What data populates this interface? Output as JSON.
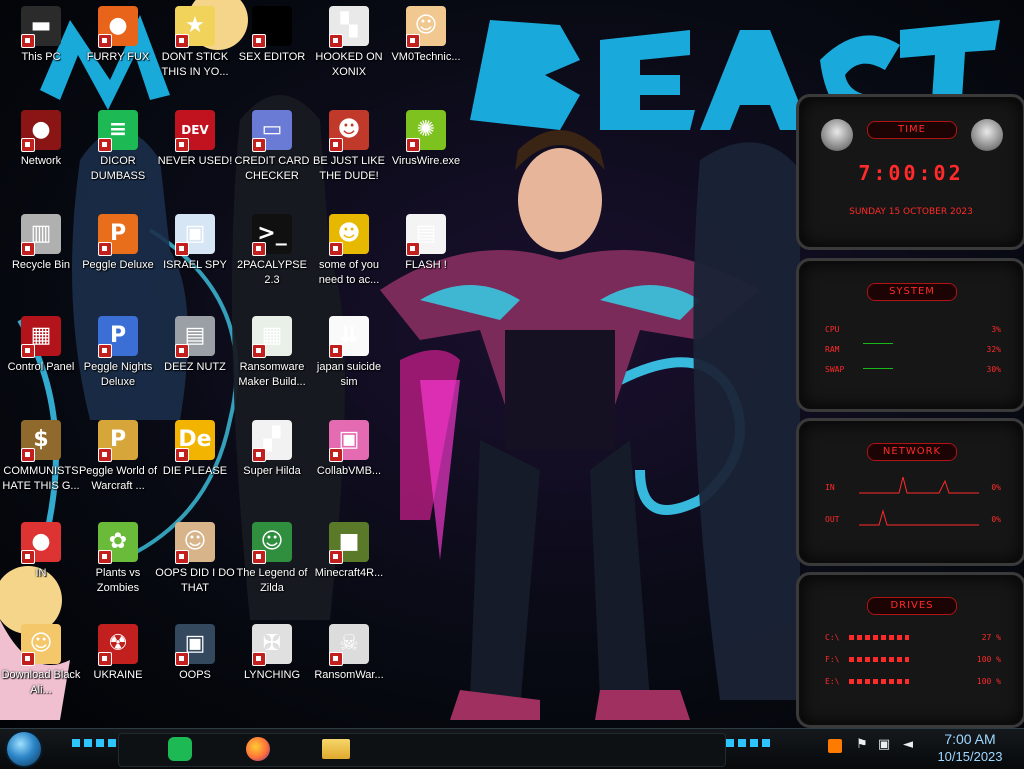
{
  "desktop": {
    "icons": [
      {
        "label": "This PC",
        "glyph": "▬",
        "bg": "#2b2b2b"
      },
      {
        "label": "FURRY FUX",
        "glyph": "●",
        "bg": "#e8641a"
      },
      {
        "label": "DONT STICK THIS IN YO...",
        "glyph": "★",
        "bg": "#f1d35c"
      },
      {
        "label": "SEX EDITOR",
        "glyph": "",
        "bg": "#000000"
      },
      {
        "label": "HOOKED ON XONIX",
        "glyph": "▚",
        "bg": "#e9e9e9"
      },
      {
        "label": "VM0Technic...",
        "glyph": "☺",
        "bg": "#f0c890"
      },
      {
        "label": "Network",
        "glyph": "●",
        "bg": "#8b1414"
      },
      {
        "label": "DICOR DUMBASS",
        "glyph": "≡",
        "bg": "#1db954"
      },
      {
        "label": "NEVER USED!",
        "glyph": "DEV",
        "bg": "#c1121f"
      },
      {
        "label": "CREDIT CARD CHECKER",
        "glyph": "▭",
        "bg": "#6a7bd6"
      },
      {
        "label": "BE JUST LIKE THE DUDE!",
        "glyph": "☻",
        "bg": "#c0392b"
      },
      {
        "label": "VirusWire.exe",
        "glyph": "✺",
        "bg": "#7dc21e"
      },
      {
        "label": "Recycle Bin",
        "glyph": "▥",
        "bg": "#b0b0b0"
      },
      {
        "label": "Peggle Deluxe",
        "glyph": "P",
        "bg": "#e86e1c"
      },
      {
        "label": "ISRAEL SPY",
        "glyph": "▣",
        "bg": "#d7e6f5"
      },
      {
        "label": "2PACALYPSE 2.3",
        "glyph": ">_",
        "bg": "#101010"
      },
      {
        "label": "some of you need to ac...",
        "glyph": "☻",
        "bg": "#e6b800"
      },
      {
        "label": "FLASH !",
        "glyph": "▤",
        "bg": "#f4f4f4"
      },
      {
        "label": "Control Panel",
        "glyph": "▦",
        "bg": "#b3141b"
      },
      {
        "label": "Peggle Nights Deluxe",
        "glyph": "P",
        "bg": "#3b6fd6"
      },
      {
        "label": "DEEZ NUTZ",
        "glyph": "▤",
        "bg": "#9aa0a6"
      },
      {
        "label": "Ransomware Maker Build...",
        "glyph": "▦",
        "bg": "#e8f0e8"
      },
      {
        "label": "japan suicide sim",
        "glyph": "⇊",
        "bg": "#fafafa"
      },
      {
        "label": "COMMUNISTS HATE THIS G...",
        "glyph": "$",
        "bg": "#8f6a2c"
      },
      {
        "label": "Peggle World of Warcraft ...",
        "glyph": "P",
        "bg": "#d7a63a"
      },
      {
        "label": "DIE PLEASE",
        "glyph": "De",
        "bg": "#f2b400"
      },
      {
        "label": "Super Hilda",
        "glyph": "▞",
        "bg": "#f2f2f2"
      },
      {
        "label": "CollabVMB...",
        "glyph": "▣",
        "bg": "#e46ab1"
      },
      {
        "label": "IN",
        "glyph": "●",
        "bg": "#d33"
      },
      {
        "label": "Plants vs Zombies",
        "glyph": "✿",
        "bg": "#6bbb3b"
      },
      {
        "label": "OOPS DID I DO THAT",
        "glyph": "☺",
        "bg": "#d8b48a"
      },
      {
        "label": "The Legend of Zilda",
        "glyph": "☺",
        "bg": "#2f8f3f"
      },
      {
        "label": "Minecraft4R...",
        "glyph": "■",
        "bg": "#5a7a2a"
      },
      {
        "label": "Download Black Ali...",
        "glyph": "☺",
        "bg": "#f4c86a"
      },
      {
        "label": "UKRAINE",
        "glyph": "☢",
        "bg": "#c21f1f"
      },
      {
        "label": "OOPS",
        "glyph": "▣",
        "bg": "#34495e"
      },
      {
        "label": "LYNCHING",
        "glyph": "✠",
        "bg": "#e0e0e0"
      },
      {
        "label": "RansomWar...",
        "glyph": "☠",
        "bg": "#dcdcdc"
      }
    ]
  },
  "gadgets": {
    "time": {
      "title": "TIME",
      "clock": "7:00:02",
      "date": "SUNDAY 15 OCTOBER 2023"
    },
    "system": {
      "title": "SYSTEM",
      "rows": [
        {
          "label": "CPU",
          "value": "3%"
        },
        {
          "label": "RAM",
          "value": "32%"
        },
        {
          "label": "SWAP",
          "value": "30%"
        }
      ]
    },
    "network": {
      "title": "NETWORK",
      "rows": [
        {
          "label": "IN",
          "value": "0%"
        },
        {
          "label": "OUT",
          "value": "0%"
        }
      ]
    },
    "drives": {
      "title": "DRIVES",
      "rows": [
        {
          "label": "C:\\",
          "value": "27 %"
        },
        {
          "label": "F:\\",
          "value": "100 %"
        },
        {
          "label": "E:\\",
          "value": "100 %"
        }
      ]
    }
  },
  "taskbar": {
    "clock_time": "7:00 AM",
    "clock_date": "10/15/2023",
    "pinned": [
      {
        "name": "spotify-icon",
        "color": "#1db954"
      },
      {
        "name": "firefox-icon",
        "color": "#ff7139"
      },
      {
        "name": "file-explorer-icon",
        "color": "#f0c341"
      }
    ]
  },
  "colors": {
    "accent_red": "#ff2a2a",
    "clock_blue": "#9fd8ff"
  }
}
